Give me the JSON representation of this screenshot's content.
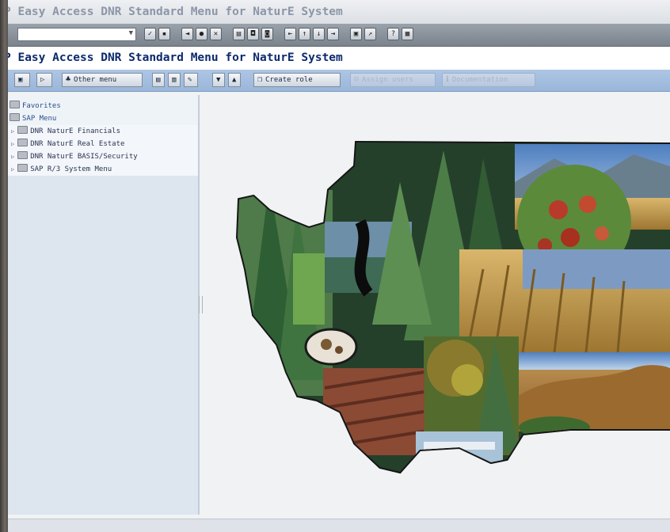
{
  "window": {
    "title": "P Easy Access  DNR Standard Menu for NaturE System"
  },
  "toolbar": {
    "command_value": "",
    "icons": [
      "enter-icon",
      "save-icon",
      "back-icon",
      "exit-icon",
      "cancel-icon",
      "print-icon",
      "find-icon",
      "find-next-icon",
      "first-page-icon",
      "prev-page-icon",
      "next-page-icon",
      "last-page-icon",
      "new-session-icon",
      "shortcut-icon",
      "help-icon",
      "layout-icon"
    ]
  },
  "app": {
    "title": "P Easy Access  DNR Standard Menu for NaturE System"
  },
  "apptoolbar": {
    "other_menu": "Other menu",
    "create_role": "Create role",
    "assign_users": "Assign users",
    "documentation": "Documentation"
  },
  "tree": {
    "favorites": "Favorites",
    "sap_menu": "SAP Menu",
    "items": [
      {
        "label": "DNR NaturE Financials"
      },
      {
        "label": "DNR NaturE Real Estate"
      },
      {
        "label": "DNR NaturE BASIS/Security"
      },
      {
        "label": "SAP R/3 System Menu"
      }
    ]
  },
  "colors": {
    "title_text": "#0d2a6d",
    "toolbar_blue": "#aec6e4",
    "tree_bg": "#dde5ef"
  }
}
